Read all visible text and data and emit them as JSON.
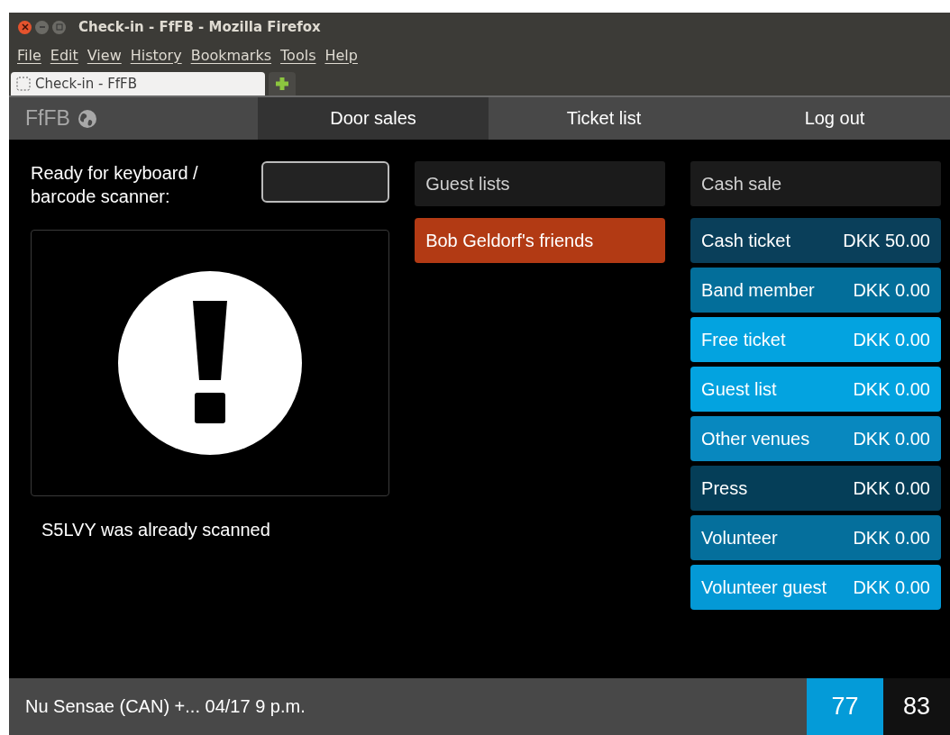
{
  "window": {
    "title": "Check-in - FfFB - Mozilla Firefox"
  },
  "menu": [
    "File",
    "Edit",
    "View",
    "History",
    "Bookmarks",
    "Tools",
    "Help"
  ],
  "browser_tab": {
    "title": "Check-in - FfFB"
  },
  "nav": {
    "brand": "FfFB",
    "tabs": [
      {
        "label": "Door sales",
        "selected": true
      },
      {
        "label": "Ticket list",
        "selected": false
      },
      {
        "label": "Log out",
        "selected": false
      }
    ]
  },
  "scanner": {
    "label": "Ready for keyboard / barcode scanner:",
    "status": "S5LVY was already scanned"
  },
  "guest_lists": {
    "title": "Guest lists",
    "items": [
      "Bob Geldorf's friends"
    ]
  },
  "cash_sale": {
    "title": "Cash sale",
    "items": [
      {
        "name": "Cash ticket",
        "price": "DKK 50.00",
        "color": "#0a3f5a"
      },
      {
        "name": "Band member",
        "price": "DKK 0.00",
        "color": "#036e9a"
      },
      {
        "name": "Free ticket",
        "price": "DKK 0.00",
        "color": "#03a3e0"
      },
      {
        "name": "Guest list",
        "price": "DKK 0.00",
        "color": "#03a3e0"
      },
      {
        "name": "Other venues",
        "price": "DKK 0.00",
        "color": "#0888bf"
      },
      {
        "name": "Press",
        "price": "DKK 0.00",
        "color": "#053e58"
      },
      {
        "name": "Volunteer",
        "price": "DKK 0.00",
        "color": "#056f9c"
      },
      {
        "name": "Volunteer guest",
        "price": "DKK 0.00",
        "color": "#0499d6"
      }
    ]
  },
  "footer": {
    "event": "Nu Sensae (CAN) +... 04/17 9 p.m.",
    "count_1": "77",
    "count_2": "83"
  }
}
